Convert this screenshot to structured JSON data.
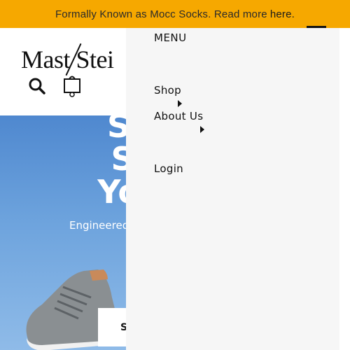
{
  "announcement": {
    "text": "Formally Known as Mocc Socks. Read more",
    "link": "here."
  },
  "header": {
    "logo_text": "Mast Stei"
  },
  "icons": {
    "search": "search-icon",
    "bag": "shopping-bag-icon",
    "menu": "hamburger-icon",
    "caret": "caret-right-icon"
  },
  "hero": {
    "title_lines": [
      "Sh",
      "St",
      "You"
    ],
    "subtitle": "Engineered",
    "button_label": "S"
  },
  "menu": {
    "title": "MENU",
    "items": [
      {
        "label": "Shop"
      },
      {
        "label": "About Us"
      },
      {
        "label": "Login"
      }
    ]
  },
  "colors": {
    "announcement_bg": "#f6a800",
    "menu_bg": "#f6f6f6",
    "hero_bg": "#5b93d6"
  }
}
